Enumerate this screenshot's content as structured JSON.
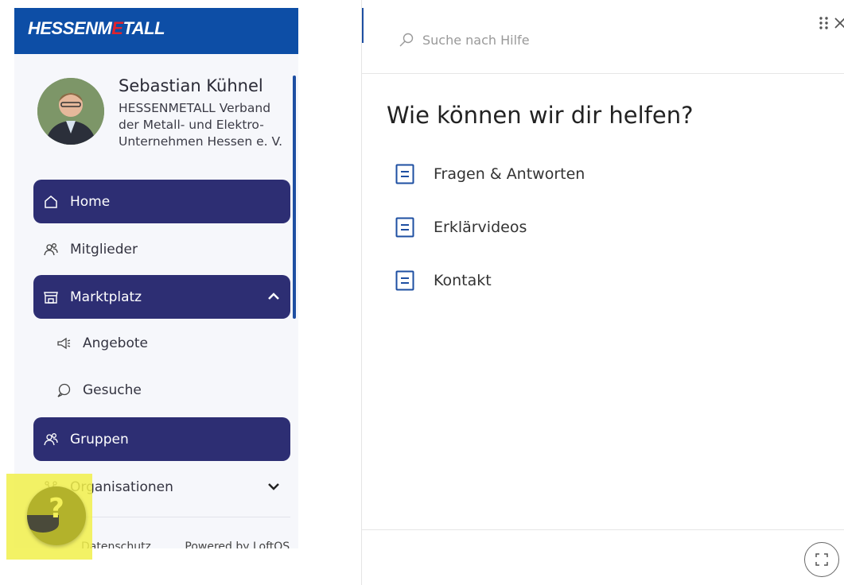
{
  "brand": {
    "prefix": "HESSENM",
    "accent": "E",
    "suffix": "TALL",
    "bar_color": "#0d4ea6",
    "accent_color": "#e3232c"
  },
  "profile": {
    "name": "Sebastian Kühnel",
    "organization": "HESSENMETALL Verband der Metall- und Elektro-Unternehmen Hessen e. V."
  },
  "nav": {
    "items": [
      {
        "label": "Home",
        "icon": "home-icon",
        "active": true
      },
      {
        "label": "Mitglieder",
        "icon": "members-icon",
        "active": false
      },
      {
        "label": "Marktplatz",
        "icon": "store-icon",
        "active": true,
        "expanded": true
      },
      {
        "label": "Angebote",
        "icon": "megaphone-icon",
        "active": false,
        "sub": true
      },
      {
        "label": "Gesuche",
        "icon": "speech-bubble-icon",
        "active": false,
        "sub": true
      },
      {
        "label": "Gruppen",
        "icon": "group-icon",
        "active": true
      },
      {
        "label": "Organisationen",
        "icon": "organization-icon",
        "active": false,
        "expanded": false
      }
    ]
  },
  "footer": {
    "privacy": "Datenschutz",
    "powered_by": "Powered by LoftOS"
  },
  "help_fab": {
    "label": "?",
    "icon": "help-icon"
  },
  "help_panel": {
    "search_placeholder": "Suche nach Hilfe",
    "heading": "Wie können wir dir helfen?",
    "links": [
      {
        "label": "Fragen & Antworten",
        "icon": "document-icon"
      },
      {
        "label": "Erklärvideos",
        "icon": "document-icon"
      },
      {
        "label": "Kontakt",
        "icon": "document-icon"
      }
    ],
    "accent_color": "#1e4fa2"
  },
  "colors": {
    "nav_active": "#2d2e73",
    "highlight": "#f1f04a"
  }
}
